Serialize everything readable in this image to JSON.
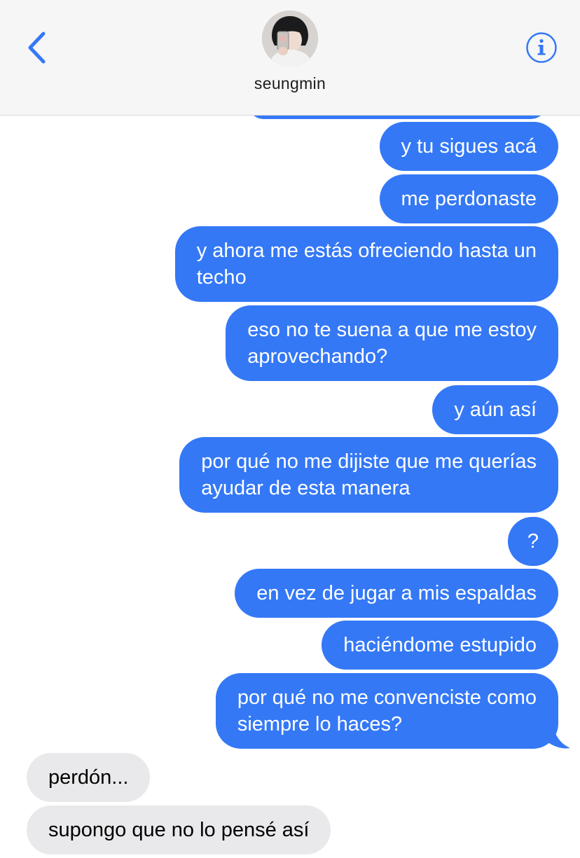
{
  "header": {
    "contact_name": "seungmin",
    "back_icon": "chevron-left-icon",
    "info_icon": "info-circle-icon",
    "accent_color": "#3478f6"
  },
  "messages": [
    {
      "from": "me",
      "text": "y tu sigues acá"
    },
    {
      "from": "me",
      "text": "me perdonaste"
    },
    {
      "from": "me",
      "lines": [
        "y ahora me estás ofreciendo hasta un",
        "techo"
      ]
    },
    {
      "from": "me",
      "lines": [
        "eso no te suena a que me estoy",
        "aprovechando?"
      ]
    },
    {
      "from": "me",
      "text": "y aún así"
    },
    {
      "from": "me",
      "lines": [
        "por qué no me dijiste que me querías",
        "ayudar de esta manera"
      ]
    },
    {
      "from": "me",
      "text": "?"
    },
    {
      "from": "me",
      "text": "en vez de jugar a mis espaldas"
    },
    {
      "from": "me",
      "text": "haciéndome estupido"
    },
    {
      "from": "me",
      "lines": [
        "por qué no me convenciste como",
        "siempre lo haces?"
      ]
    },
    {
      "from": "them",
      "text": "perdón..."
    },
    {
      "from": "them",
      "text": "supongo que no lo pensé así"
    }
  ],
  "colors": {
    "sent_bubble": "#3478f6",
    "received_bubble": "#e9e9eb",
    "header_bg": "#f6f6f6"
  }
}
